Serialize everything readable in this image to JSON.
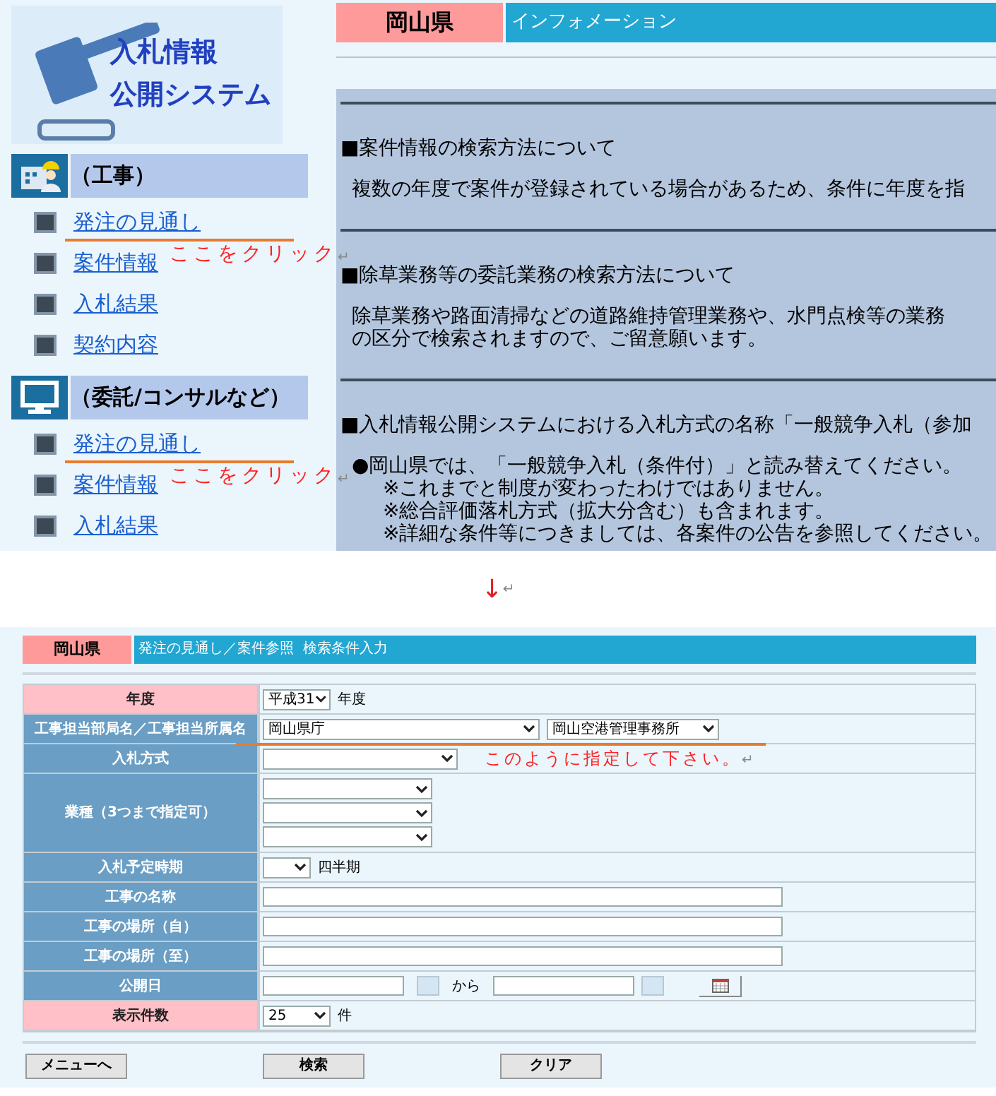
{
  "top_screen": {
    "logo": {
      "lines": [
        "入札情報",
        "公開システム"
      ]
    },
    "sections": [
      {
        "kind": "construction",
        "title": "（工事）",
        "links": [
          {
            "label": "発注の見通し",
            "annotation": {
              "text": "ここをクリック",
              "mark": "↵"
            }
          },
          {
            "label": "案件情報"
          },
          {
            "label": "入札結果"
          },
          {
            "label": "契約内容"
          }
        ]
      },
      {
        "kind": "consulting",
        "title": "（委託/コンサルなど）",
        "links": [
          {
            "label": "発注の見通し",
            "annotation": {
              "text": "ここをクリック",
              "mark": "↵"
            }
          },
          {
            "label": "案件情報"
          },
          {
            "label": "入札結果"
          }
        ]
      }
    ],
    "header": {
      "prefecture": "岡山県",
      "title": "インフォメーション"
    },
    "notices": [
      {
        "heading": "■案件情報の検索方法について",
        "lines": [
          "複数の年度で案件が登録されている場合があるため、条件に年度を指"
        ]
      },
      {
        "heading": "■除草業務等の委託業務の検索方法について",
        "lines": [
          "除草業務や路面清掃などの道路維持管理業務や、水門点検等の業務",
          "の区分で検索されますので、ご留意願います。"
        ]
      },
      {
        "heading": "■入札情報公開システムにおける入札方式の名称「一般競争入札（参加",
        "lines": [
          "●岡山県では、「一般競争入札（条件付）」と読み替えてください。",
          "※これまでと制度が変わったわけではありません。",
          "※総合評価落札方式（拡大分含む）も含まれます。",
          "※詳細な条件等につきましては、各案件の公告を参照してください。"
        ]
      }
    ]
  },
  "arrow": {
    "text": "↓",
    "mark": "↵"
  },
  "bottom_screen": {
    "header": {
      "prefecture": "岡山県",
      "title": "発注の見通し／案件参照  検索条件入力"
    },
    "rows": [
      {
        "label": "年度",
        "highlighted": true,
        "kind": "select",
        "selects": [
          {
            "kind": "filled",
            "value": "平成31"
          }
        ],
        "suffix": "年度"
      },
      {
        "label": "工事担当部局名／工事担当所属名",
        "highlighted": false,
        "kind": "select",
        "underlined": true,
        "selects": [
          {
            "kind": "filled",
            "value": "岡山県庁"
          },
          {
            "kind": "filled",
            "value": "岡山空港管理事務所"
          }
        ]
      },
      {
        "label": "入札方式",
        "highlighted": false,
        "kind": "select",
        "selects": [
          {
            "kind": "blank"
          }
        ],
        "annotation": {
          "text": "このように指定して下さい。",
          "mark": "↵"
        }
      },
      {
        "label": "業種（3つまで指定可）",
        "highlighted": false,
        "kind": "select_stack",
        "selects": [
          {
            "kind": "blank"
          },
          {
            "kind": "blank"
          },
          {
            "kind": "blank"
          }
        ]
      },
      {
        "label": "入札予定時期",
        "highlighted": false,
        "kind": "select",
        "selects": [
          {
            "kind": "blank"
          }
        ],
        "suffix": "四半期"
      },
      {
        "label": "工事の名称",
        "highlighted": false,
        "kind": "text"
      },
      {
        "label": "工事の場所（自）",
        "highlighted": false,
        "kind": "text"
      },
      {
        "label": "工事の場所（至）",
        "highlighted": false,
        "kind": "text"
      },
      {
        "label": "公開日",
        "highlighted": false,
        "kind": "date_range",
        "between": "から"
      },
      {
        "label": "表示件数",
        "highlighted": true,
        "kind": "select",
        "selects": [
          {
            "kind": "filled",
            "value": "25"
          }
        ],
        "suffix": "件"
      }
    ],
    "buttons": [
      "メニューへ",
      "検索",
      "クリア"
    ]
  }
}
